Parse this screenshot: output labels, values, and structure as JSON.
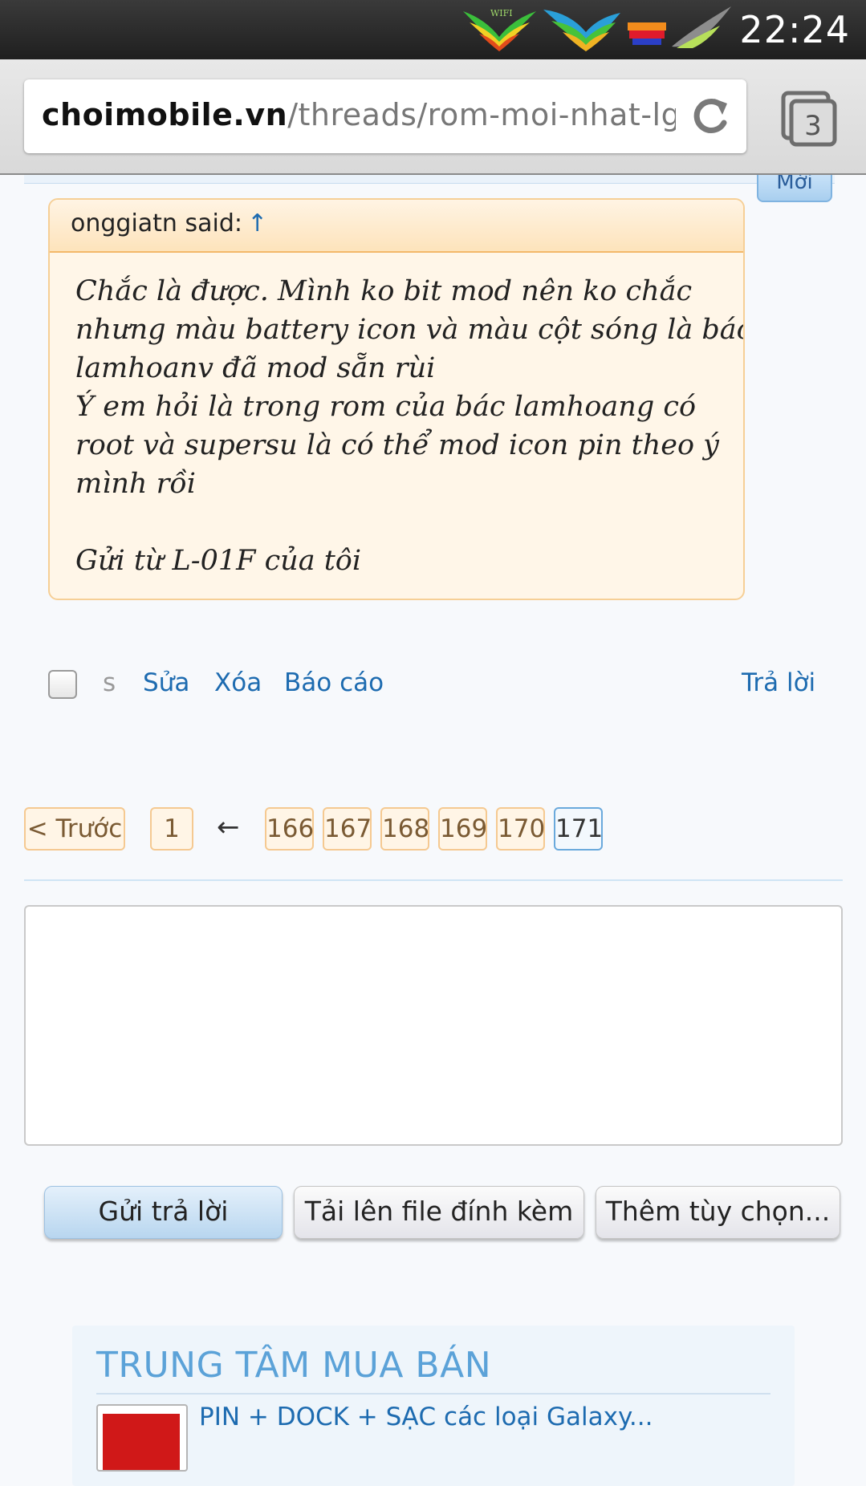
{
  "status_bar": {
    "time": "22:24",
    "wifi_label": "WIFI",
    "icons": [
      "wifi-wing-icon",
      "signal-wing-icon",
      "battery-icon",
      "gray-wing-icon"
    ]
  },
  "browser": {
    "url_domain": "choimobile.vn",
    "url_path": "/threads/rom-moi-nhat-lg",
    "tab_count": "3"
  },
  "post": {
    "new_badge": "Mới",
    "quote_author": "onggiatn said:",
    "quote_arrow": "↑",
    "quote_lines": [
      "Chắc là được. Mình ko bit mod nên ko chắc",
      "nhưng màu battery icon và màu cột sóng là bác",
      "lamhoanv đã mod sẵn rùi",
      "Ý em hỏi là trong rom của bác lamhoang có",
      "root và supersu là có thể mod icon pin theo ý",
      "mình rồi"
    ],
    "quote_signature": "Gửi từ L-01F của tôi",
    "actions": {
      "s": "s",
      "edit": "Sửa",
      "delete": "Xóa",
      "report": "Báo cáo",
      "reply": "Trả lời"
    }
  },
  "pagination": {
    "prev": "< Trước",
    "first": "1",
    "skip": "←",
    "pages": [
      "166",
      "167",
      "168",
      "169",
      "170",
      "171"
    ],
    "current": "171"
  },
  "reply_form": {
    "text_value": "",
    "submit": "Gửi trả lời",
    "upload": "Tải lên file đính kèm",
    "more": "Thêm tùy chọn..."
  },
  "shop": {
    "title": "TRUNG TÂM MUA BÁN",
    "item": "PIN + DOCK + SẠC các loại Galaxy..."
  }
}
